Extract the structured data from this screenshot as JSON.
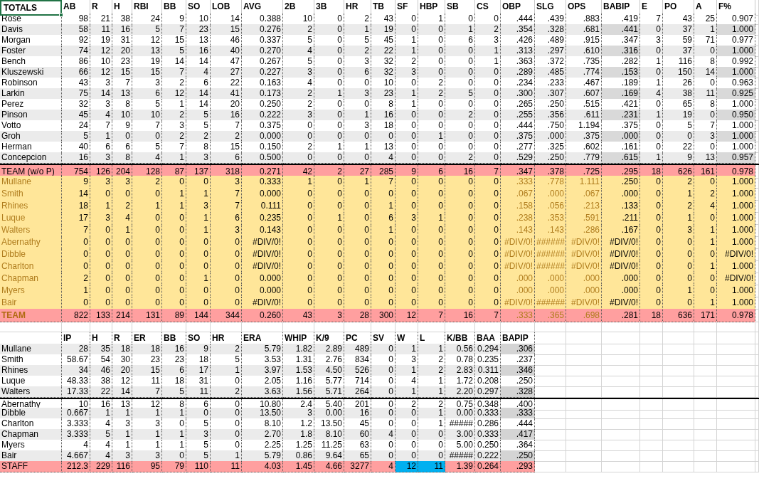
{
  "batting": {
    "columns": [
      {
        "label": "TOTALS",
        "selected": true
      },
      {
        "label": "AB",
        "selected": false
      },
      {
        "label": "R",
        "selected": false
      },
      {
        "label": "H",
        "selected": false
      },
      {
        "label": "RBI",
        "selected": false
      },
      {
        "label": "BB",
        "selected": false
      },
      {
        "label": "SO",
        "selected": false
      },
      {
        "label": "LOB",
        "selected": false
      },
      {
        "label": "AVG",
        "selected": false
      },
      {
        "label": "2B",
        "selected": false
      },
      {
        "label": "3B",
        "selected": false
      },
      {
        "label": "HR",
        "selected": false
      },
      {
        "label": "TB",
        "selected": false
      },
      {
        "label": "SF",
        "selected": false
      },
      {
        "label": "HBP",
        "selected": false
      },
      {
        "label": "SB",
        "selected": false
      },
      {
        "label": "CS",
        "selected": false
      },
      {
        "label": "OBP",
        "selected": false
      },
      {
        "label": "SLG",
        "selected": false
      },
      {
        "label": "OPS",
        "selected": false
      },
      {
        "label": "BABIP",
        "selected": false
      },
      {
        "label": "E",
        "selected": false
      },
      {
        "label": "PO",
        "selected": false
      },
      {
        "label": "A",
        "selected": false
      },
      {
        "label": "F%",
        "selected": false
      }
    ],
    "rows": [
      {
        "kind": "position",
        "shaded": false,
        "divider_above": false,
        "cells": [
          "Rose",
          "98",
          "21",
          "38",
          "24",
          "9",
          "10",
          "14",
          "0.388",
          "10",
          "0",
          "2",
          "43",
          "0",
          "1",
          "0",
          "0",
          ".444",
          ".439",
          ".883",
          ".419",
          "7",
          "43",
          "25",
          "0.907"
        ]
      },
      {
        "kind": "position",
        "shaded": true,
        "divider_above": false,
        "cells": [
          "Davis",
          "58",
          "11",
          "16",
          "5",
          "7",
          "23",
          "15",
          "0.276",
          "2",
          "0",
          "1",
          "19",
          "0",
          "0",
          "1",
          "2",
          ".354",
          ".328",
          ".681",
          ".441",
          "0",
          "37",
          "1",
          "1.000"
        ]
      },
      {
        "kind": "position",
        "shaded": false,
        "divider_above": false,
        "cells": [
          "Morgan",
          "92",
          "19",
          "31",
          "12",
          "15",
          "13",
          "46",
          "0.337",
          "5",
          "0",
          "5",
          "45",
          "1",
          "0",
          "6",
          "3",
          ".426",
          ".489",
          ".915",
          ".347",
          "3",
          "59",
          "71",
          "0.977"
        ]
      },
      {
        "kind": "position",
        "shaded": true,
        "divider_above": false,
        "cells": [
          "Foster",
          "74",
          "12",
          "20",
          "13",
          "5",
          "16",
          "40",
          "0.270",
          "4",
          "0",
          "2",
          "22",
          "1",
          "0",
          "0",
          "1",
          ".313",
          ".297",
          ".610",
          ".316",
          "0",
          "37",
          "0",
          "1.000"
        ]
      },
      {
        "kind": "position",
        "shaded": false,
        "divider_above": false,
        "cells": [
          "Bench",
          "86",
          "10",
          "23",
          "19",
          "14",
          "14",
          "47",
          "0.267",
          "5",
          "0",
          "3",
          "32",
          "2",
          "0",
          "0",
          "1",
          ".363",
          ".372",
          ".735",
          ".282",
          "1",
          "116",
          "8",
          "0.992"
        ]
      },
      {
        "kind": "position",
        "shaded": true,
        "divider_above": false,
        "cells": [
          "Kluszewski",
          "66",
          "12",
          "15",
          "15",
          "7",
          "4",
          "27",
          "0.227",
          "3",
          "0",
          "6",
          "32",
          "3",
          "0",
          "0",
          "0",
          ".289",
          ".485",
          ".774",
          ".153",
          "0",
          "150",
          "14",
          "1.000"
        ]
      },
      {
        "kind": "position",
        "shaded": false,
        "divider_above": false,
        "cells": [
          "Robinson",
          "43",
          "3",
          "7",
          "3",
          "2",
          "6",
          "22",
          "0.163",
          "4",
          "0",
          "0",
          "10",
          "0",
          "2",
          "0",
          "0",
          ".234",
          ".233",
          ".467",
          ".189",
          "1",
          "26",
          "0",
          "0.963"
        ]
      },
      {
        "kind": "position",
        "shaded": true,
        "divider_above": false,
        "cells": [
          "Larkin",
          "75",
          "14",
          "13",
          "6",
          "12",
          "14",
          "41",
          "0.173",
          "2",
          "1",
          "3",
          "23",
          "1",
          "2",
          "5",
          "0",
          ".300",
          ".307",
          ".607",
          ".169",
          "4",
          "38",
          "11",
          "0.925"
        ]
      },
      {
        "kind": "position",
        "shaded": false,
        "divider_above": false,
        "cells": [
          "Perez",
          "32",
          "3",
          "8",
          "5",
          "1",
          "14",
          "20",
          "0.250",
          "2",
          "0",
          "0",
          "8",
          "1",
          "0",
          "0",
          "0",
          ".265",
          ".250",
          ".515",
          ".421",
          "0",
          "65",
          "8",
          "1.000"
        ]
      },
      {
        "kind": "position",
        "shaded": true,
        "divider_above": false,
        "cells": [
          "Pinson",
          "45",
          "4",
          "10",
          "10",
          "2",
          "5",
          "16",
          "0.222",
          "3",
          "0",
          "1",
          "16",
          "0",
          "0",
          "2",
          "0",
          ".255",
          ".356",
          ".611",
          ".231",
          "1",
          "19",
          "0",
          "0.950"
        ]
      },
      {
        "kind": "position",
        "shaded": false,
        "divider_above": false,
        "cells": [
          "Votto",
          "24",
          "7",
          "9",
          "7",
          "3",
          "5",
          "7",
          "0.375",
          "0",
          "0",
          "3",
          "18",
          "0",
          "0",
          "0",
          "0",
          ".444",
          ".750",
          "1.194",
          ".375",
          "0",
          "5",
          "7",
          "1.000"
        ]
      },
      {
        "kind": "position",
        "shaded": true,
        "divider_above": false,
        "cells": [
          "Groh",
          "5",
          "1",
          "0",
          "0",
          "2",
          "2",
          "2",
          "0.000",
          "0",
          "0",
          "0",
          "0",
          "0",
          "1",
          "0",
          "0",
          ".375",
          ".000",
          ".375",
          ".000",
          "0",
          "0",
          "3",
          "1.000"
        ]
      },
      {
        "kind": "position",
        "shaded": false,
        "divider_above": false,
        "cells": [
          "Herman",
          "40",
          "6",
          "6",
          "5",
          "7",
          "8",
          "15",
          "0.150",
          "2",
          "1",
          "1",
          "13",
          "0",
          "0",
          "0",
          "0",
          ".277",
          ".325",
          ".602",
          ".161",
          "0",
          "22",
          "0",
          "1.000"
        ]
      },
      {
        "kind": "position",
        "shaded": true,
        "divider_above": false,
        "cells": [
          "Concepcion",
          "16",
          "3",
          "8",
          "4",
          "1",
          "3",
          "6",
          "0.500",
          "0",
          "0",
          "0",
          "4",
          "0",
          "0",
          "2",
          "0",
          ".529",
          ".250",
          ".779",
          ".615",
          "1",
          "9",
          "13",
          "0.957"
        ]
      },
      {
        "kind": "subtotal",
        "divider_above": true,
        "cells": [
          "TEAM (w/o P)",
          "754",
          "126",
          "204",
          "128",
          "87",
          "137",
          "318",
          "0.271",
          "42",
          "2",
          "27",
          "285",
          "9",
          "6",
          "16",
          "7",
          ".347",
          ".378",
          ".725",
          ".295",
          "18",
          "626",
          "161",
          "0.978"
        ]
      },
      {
        "kind": "pitcher",
        "divider_above": false,
        "cells": [
          "Mullane",
          "9",
          "3",
          "3",
          "2",
          "0",
          "0",
          "3",
          "0.333",
          "1",
          "0",
          "1",
          "7",
          "0",
          "0",
          "0",
          "0",
          ".333",
          ".778",
          "1.111",
          ".250",
          "0",
          "2",
          "0",
          "1.000"
        ]
      },
      {
        "kind": "pitcher",
        "divider_above": false,
        "cells": [
          "Smith",
          "14",
          "0",
          "0",
          "0",
          "1",
          "1",
          "7",
          "0.000",
          "0",
          "0",
          "0",
          "0",
          "0",
          "0",
          "0",
          "0",
          ".067",
          ".000",
          ".067",
          ".000",
          "0",
          "1",
          "2",
          "1.000"
        ]
      },
      {
        "kind": "pitcher",
        "divider_above": false,
        "cells": [
          "Rhines",
          "18",
          "1",
          "2",
          "1",
          "1",
          "3",
          "7",
          "0.111",
          "0",
          "0",
          "0",
          "1",
          "0",
          "0",
          "0",
          "0",
          ".158",
          ".056",
          ".213",
          ".133",
          "0",
          "2",
          "4",
          "1.000"
        ]
      },
      {
        "kind": "pitcher",
        "divider_above": false,
        "cells": [
          "Luque",
          "17",
          "3",
          "4",
          "0",
          "0",
          "1",
          "6",
          "0.235",
          "0",
          "1",
          "0",
          "6",
          "3",
          "1",
          "0",
          "0",
          ".238",
          ".353",
          ".591",
          ".211",
          "0",
          "1",
          "0",
          "1.000"
        ]
      },
      {
        "kind": "pitcher",
        "divider_above": false,
        "cells": [
          "Walters",
          "7",
          "0",
          "1",
          "0",
          "0",
          "1",
          "3",
          "0.143",
          "0",
          "0",
          "0",
          "1",
          "0",
          "0",
          "0",
          "0",
          ".143",
          ".143",
          ".286",
          ".167",
          "0",
          "3",
          "1",
          "1.000"
        ]
      },
      {
        "kind": "pitcher",
        "divider_above": false,
        "cells": [
          "Abernathy",
          "0",
          "0",
          "0",
          "0",
          "0",
          "0",
          "0",
          "#DIV/0!",
          "0",
          "0",
          "0",
          "0",
          "0",
          "0",
          "0",
          "0",
          "#DIV/0!",
          "######",
          "#DIV/0!",
          "#DIV/0!",
          "0",
          "0",
          "1",
          "1.000"
        ]
      },
      {
        "kind": "pitcher",
        "divider_above": false,
        "cells": [
          "Dibble",
          "0",
          "0",
          "0",
          "0",
          "0",
          "0",
          "0",
          "#DIV/0!",
          "0",
          "0",
          "0",
          "0",
          "0",
          "0",
          "0",
          "0",
          "#DIV/0!",
          "######",
          "#DIV/0!",
          "#DIV/0!",
          "0",
          "0",
          "0",
          "#DIV/0!"
        ]
      },
      {
        "kind": "pitcher",
        "divider_above": false,
        "cells": [
          "Charlton",
          "0",
          "0",
          "0",
          "0",
          "0",
          "0",
          "0",
          "#DIV/0!",
          "0",
          "0",
          "0",
          "0",
          "0",
          "0",
          "0",
          "0",
          "#DIV/0!",
          "######",
          "#DIV/0!",
          "#DIV/0!",
          "0",
          "0",
          "1",
          "1.000"
        ]
      },
      {
        "kind": "pitcher",
        "divider_above": false,
        "cells": [
          "Chapman",
          "2",
          "0",
          "0",
          "0",
          "0",
          "1",
          "0",
          "0.000",
          "0",
          "0",
          "0",
          "0",
          "0",
          "0",
          "0",
          "0",
          ".000",
          ".000",
          ".000",
          ".000",
          "0",
          "0",
          "0",
          "#DIV/0!"
        ]
      },
      {
        "kind": "pitcher",
        "divider_above": false,
        "cells": [
          "Myers",
          "1",
          "0",
          "0",
          "0",
          "0",
          "0",
          "0",
          "0.000",
          "0",
          "0",
          "0",
          "0",
          "0",
          "0",
          "0",
          "0",
          ".000",
          ".000",
          ".000",
          ".000",
          "0",
          "1",
          "0",
          "1.000"
        ]
      },
      {
        "kind": "pitcher",
        "divider_above": false,
        "cells": [
          "Bair",
          "0",
          "0",
          "0",
          "0",
          "0",
          "0",
          "0",
          "#DIV/0!",
          "0",
          "0",
          "0",
          "0",
          "0",
          "0",
          "0",
          "0",
          "#DIV/0!",
          "######",
          "#DIV/0!",
          "#DIV/0!",
          "0",
          "0",
          "1",
          "1.000"
        ]
      },
      {
        "kind": "total",
        "divider_above": false,
        "cells": [
          "TEAM",
          "822",
          "133",
          "214",
          "131",
          "89",
          "144",
          "344",
          "0.260",
          "43",
          "3",
          "28",
          "300",
          "12",
          "7",
          "16",
          "7",
          ".333",
          ".365",
          ".698",
          ".281",
          "18",
          "636",
          "171",
          "0.978"
        ]
      }
    ]
  },
  "pitching": {
    "columns": [
      "",
      "IP",
      "H",
      "R",
      "ER",
      "BB",
      "SO",
      "HR",
      "ERA",
      "WHIP",
      "K/9",
      "PC",
      "SV",
      "W",
      "L",
      "K/BB",
      "BAA",
      "BAPIP"
    ],
    "rows": [
      {
        "kind": "pitcher",
        "shaded": true,
        "divider_above": false,
        "cells": [
          "Mullane",
          "28",
          "35",
          "18",
          "18",
          "16",
          "9",
          "2",
          "5.79",
          "1.82",
          "2.89",
          "489",
          "0",
          "1",
          "1",
          "0.56",
          "0.294",
          ".306"
        ]
      },
      {
        "kind": "pitcher",
        "shaded": false,
        "divider_above": false,
        "cells": [
          "Smith",
          "58.67",
          "54",
          "30",
          "23",
          "23",
          "18",
          "5",
          "3.53",
          "1.31",
          "2.76",
          "834",
          "0",
          "3",
          "2",
          "0.78",
          "0.235",
          ".237"
        ]
      },
      {
        "kind": "pitcher",
        "shaded": true,
        "divider_above": false,
        "cells": [
          "Rhines",
          "34",
          "46",
          "20",
          "15",
          "6",
          "17",
          "1",
          "3.97",
          "1.53",
          "4.50",
          "526",
          "0",
          "1",
          "2",
          "2.83",
          "0.311",
          ".346"
        ]
      },
      {
        "kind": "pitcher",
        "shaded": false,
        "divider_above": false,
        "cells": [
          "Luque",
          "48.33",
          "38",
          "12",
          "11",
          "18",
          "31",
          "0",
          "2.05",
          "1.16",
          "5.77",
          "714",
          "0",
          "4",
          "1",
          "1.72",
          "0.208",
          ".250"
        ]
      },
      {
        "kind": "pitcher",
        "shaded": true,
        "divider_above": false,
        "cells": [
          "Walters",
          "17.33",
          "22",
          "14",
          "7",
          "5",
          "11",
          "2",
          "3.63",
          "1.56",
          "5.71",
          "264",
          "0",
          "1",
          "1",
          "2.20",
          "0.297",
          ".328"
        ]
      },
      {
        "kind": "pitcher",
        "shaded": false,
        "divider_above": true,
        "cells": [
          "Abernathy",
          "10",
          "16",
          "13",
          "12",
          "8",
          "6",
          "0",
          "10.80",
          "2.4",
          "5.40",
          "201",
          "0",
          "2",
          "2",
          "0.75",
          "0.348",
          ".400"
        ]
      },
      {
        "kind": "pitcher",
        "shaded": true,
        "divider_above": false,
        "cells": [
          "Dibble",
          "0.667",
          "1",
          "1",
          "1",
          "1",
          "0",
          "0",
          "13.50",
          "3",
          "0.00",
          "16",
          "0",
          "0",
          "1",
          "0.00",
          "0.333",
          ".333"
        ]
      },
      {
        "kind": "pitcher",
        "shaded": false,
        "divider_above": false,
        "cells": [
          "Charlton",
          "3.333",
          "4",
          "3",
          "3",
          "0",
          "5",
          "0",
          "8.10",
          "1.2",
          "13.50",
          "45",
          "0",
          "0",
          "1",
          "#####",
          "0.286",
          ".444"
        ]
      },
      {
        "kind": "pitcher",
        "shaded": true,
        "divider_above": false,
        "cells": [
          "Chapman",
          "3.333",
          "5",
          "1",
          "1",
          "1",
          "3",
          "0",
          "2.70",
          "1.8",
          "8.10",
          "60",
          "4",
          "0",
          "0",
          "3.00",
          "0.333",
          ".417"
        ]
      },
      {
        "kind": "pitcher",
        "shaded": false,
        "divider_above": false,
        "cells": [
          "Myers",
          "4",
          "4",
          "1",
          "1",
          "1",
          "5",
          "0",
          "2.25",
          "1.25",
          "11.25",
          "63",
          "0",
          "0",
          "0",
          "5.00",
          "0.250",
          ".364"
        ]
      },
      {
        "kind": "pitcher",
        "shaded": true,
        "divider_above": false,
        "cells": [
          "Bair",
          "4.667",
          "4",
          "3",
          "3",
          "0",
          "5",
          "1",
          "5.79",
          "0.86",
          "9.64",
          "65",
          "0",
          "0",
          "0",
          "#####",
          "0.222",
          ".250"
        ]
      },
      {
        "kind": "staff",
        "divider_above": false,
        "cells": [
          "STAFF",
          "212.3",
          "229",
          "116",
          "95",
          "79",
          "110",
          "11",
          "4.03",
          "1.45",
          "4.66",
          "3277",
          "4",
          "12",
          "11",
          "1.39",
          "0.264",
          ".293"
        ]
      }
    ]
  }
}
